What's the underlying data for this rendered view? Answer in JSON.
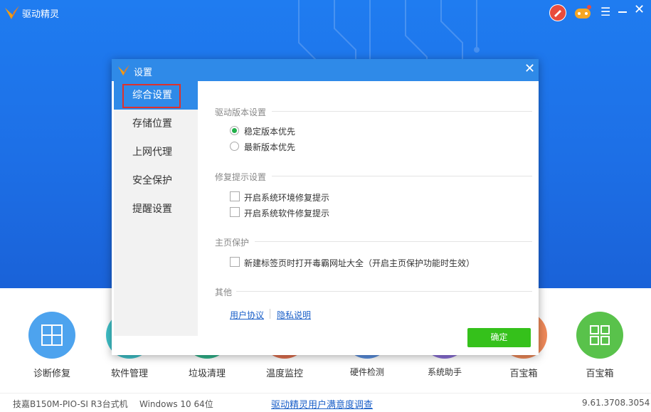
{
  "app": {
    "title": "驱动精灵",
    "menu_glyph": "☰",
    "close_glyph": "✕"
  },
  "features": [
    {
      "label": "诊断修复",
      "color": "#4da3ee"
    },
    {
      "label": "软件管理",
      "color": "#3fc1c9"
    },
    {
      "label": "垃圾清理",
      "color": "#2fb38a"
    },
    {
      "label": "温度监控",
      "color": "#e0704f"
    },
    {
      "label": "硬件检测",
      "color": "#5a8fde"
    },
    {
      "label": "系统助手",
      "color": "#8a6fd6"
    },
    {
      "label": "百宝箱",
      "color": "#f08a5a"
    },
    {
      "label": "百宝箱",
      "color": "#59c24b"
    }
  ],
  "status": {
    "model": "技嘉B150M-PIO-SI R3台式机",
    "os": "Windows 10 64位",
    "survey": "驱动精灵用户满意度调查",
    "version": "9.61.3708.3054"
  },
  "dialog": {
    "title": "设置",
    "close_glyph": "✕",
    "nav": [
      "综合设置",
      "存储位置",
      "上网代理",
      "安全保护",
      "提醒设置"
    ],
    "active_nav": "综合设置",
    "sections": {
      "driver_version": {
        "title": "驱动版本设置",
        "options": [
          {
            "label": "稳定版本优先",
            "selected": true
          },
          {
            "label": "最新版本优先",
            "selected": false
          }
        ]
      },
      "repair_hint": {
        "title": "修复提示设置",
        "options": [
          {
            "label": "开启系统环境修复提示",
            "checked": false
          },
          {
            "label": "开启系统软件修复提示",
            "checked": false
          }
        ]
      },
      "home_protect": {
        "title": "主页保护",
        "options": [
          {
            "label": "新建标签页时打开毒霸网址大全（开启主页保护功能时生效）",
            "checked": false
          }
        ]
      },
      "other": {
        "title": "其他",
        "links": [
          "用户协议",
          "隐私说明"
        ]
      }
    },
    "ok_label": "确定"
  },
  "colors": {
    "brand_blue": "#1f7cf0",
    "dialog_header": "#2f8ae8",
    "ok_green": "#35c11b",
    "radio_on": "#22b04a",
    "highlight_red": "#e0312a"
  }
}
